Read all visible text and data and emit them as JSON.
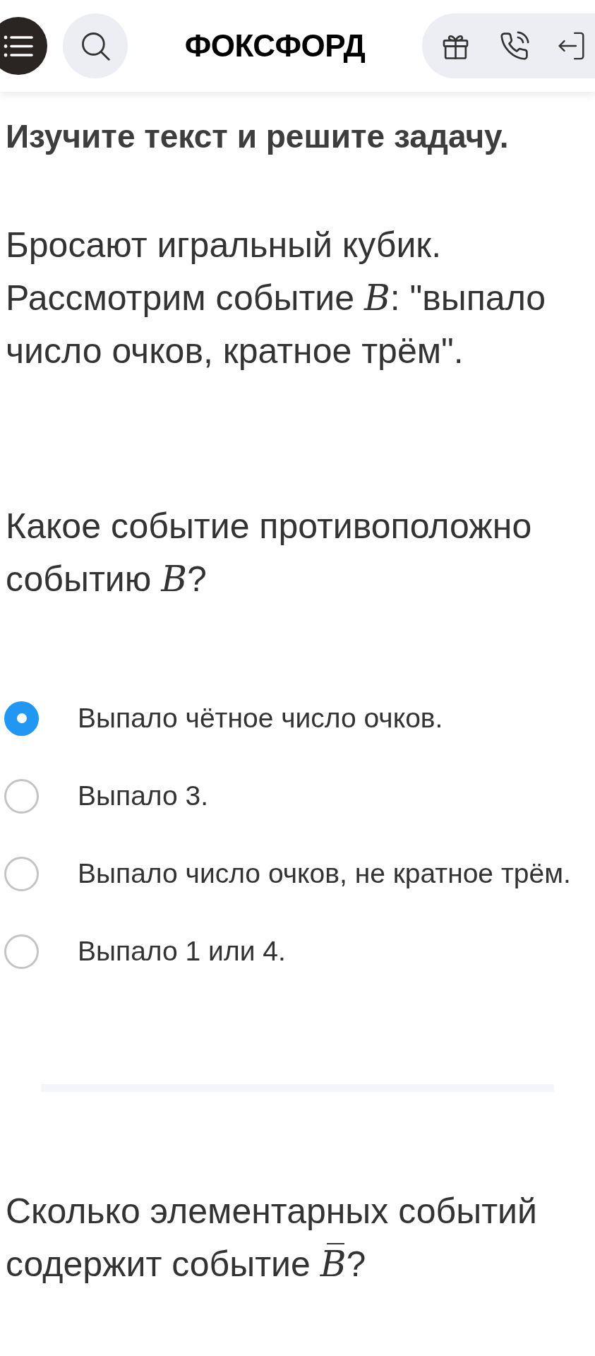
{
  "header": {
    "logo": "ФОКСФОРД"
  },
  "task": {
    "title": "Изучите текст и решите задачу.",
    "text": "Бросают игральный кубик. Рассмотрим событие *B*: \"выпало число очков, кратное трём\"."
  },
  "questions": [
    {
      "text": "Какое событие противоположно событию *B*?",
      "options": [
        {
          "label": "Выпало чётное число очков.",
          "selected": true
        },
        {
          "label": "Выпало 3.",
          "selected": false
        },
        {
          "label": "Выпало число очков, не кратное трём.",
          "selected": false
        },
        {
          "label": "Выпало 1 или 4.",
          "selected": false
        }
      ]
    },
    {
      "text": "Сколько элементарных событий содержит событие *B̅*?"
    }
  ]
}
